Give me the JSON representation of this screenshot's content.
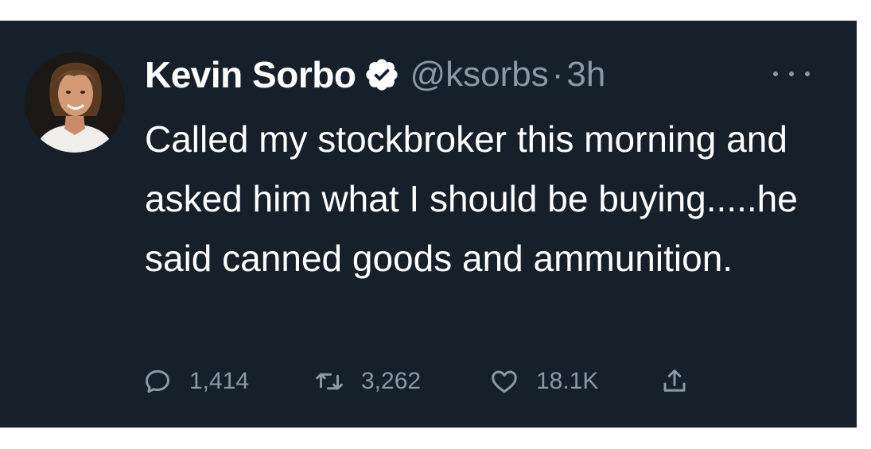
{
  "tweet": {
    "author": {
      "display_name": "Kevin Sorbo",
      "handle": "@ksorbs",
      "verified": true,
      "avatar_icon": "profile-photo"
    },
    "separator": "·",
    "timestamp": "3h",
    "text": "Called my stockbroker this morning and asked him what I should be buying.....he said canned goods and ammunition.",
    "actions": {
      "reply": {
        "icon": "reply-icon",
        "count": "1,414"
      },
      "retweet": {
        "icon": "retweet-icon",
        "count": "3,262"
      },
      "like": {
        "icon": "heart-icon",
        "count": "18.1K"
      },
      "share": {
        "icon": "share-icon"
      }
    },
    "more_icon": "more-icon"
  },
  "colors": {
    "background": "#15202b",
    "text_primary": "#ffffff",
    "text_secondary": "#8b98a5"
  }
}
